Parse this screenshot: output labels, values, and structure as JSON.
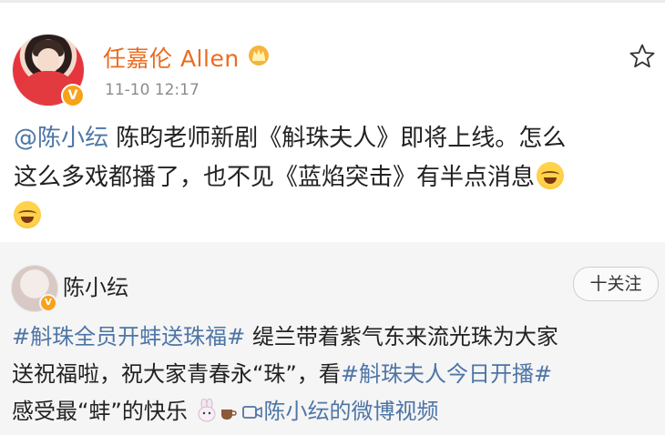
{
  "post": {
    "author": "任嘉伦 Allen",
    "timestamp": "11-10 12:17",
    "mention": "@陈小纭",
    "text_line1": " 陈昀老师新剧《斛珠夫人》即将上线。怎么",
    "text_line2": "这么多戏都播了，也不见《蓝焰突击》有半点消息",
    "emoji_name": "laugh-cry-emoji",
    "verified_badge": "V",
    "crown_icon": "crown-icon",
    "star_icon": "star-icon"
  },
  "repost": {
    "author": "陈小纭",
    "verified_badge": "V",
    "follow_label": "十关注",
    "hashtag1": "#斛珠全员开蚌送珠福#",
    "text1": " 缇兰带着紫气东来流光珠为大家",
    "text2": "送祝福啦，祝大家青春永“珠”，看",
    "hashtag2": "#斛珠夫人今日开播#",
    "text3": "感受最“蚌”的快乐",
    "video_link": "陈小纭的微博视频",
    "rabbit_icon": "rabbit-emoji",
    "cup_icon": "cup-emoji",
    "video_icon": "video-icon"
  },
  "colors": {
    "author_orange": "#eb6b1f",
    "link_blue": "#4d75a6",
    "repost_bg": "#f5f5f5"
  }
}
